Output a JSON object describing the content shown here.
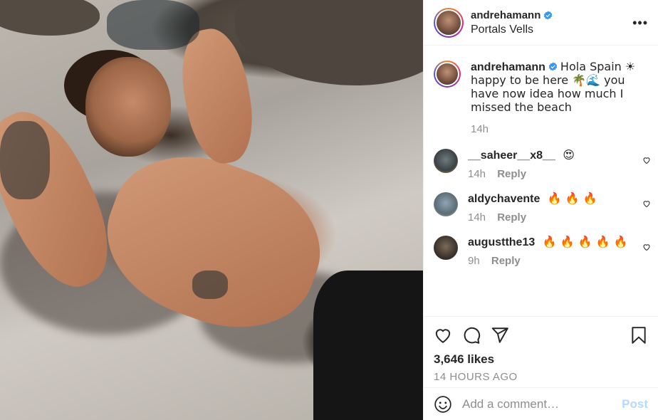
{
  "post": {
    "username": "andrehamann",
    "location": "Portals Vells",
    "more_label": "•••"
  },
  "caption": {
    "username": "andrehamann",
    "text": "Hola Spain ☀ happy to be here 🌴🌊 you have now idea how much I missed the beach",
    "time": "14h"
  },
  "comments": [
    {
      "username": "__saheer__x8__",
      "text": "😍",
      "time": "14h",
      "reply_label": "Reply"
    },
    {
      "username": "aldychavente",
      "text": "🔥 🔥 🔥",
      "time": "14h",
      "reply_label": "Reply"
    },
    {
      "username": "augustthe13",
      "text": "🔥 🔥 🔥 🔥 🔥",
      "time": "9h",
      "reply_label": "Reply"
    }
  ],
  "actions": {
    "likes": "3,646 likes",
    "time_ago": "14 HOURS AGO"
  },
  "add_comment": {
    "placeholder": "Add a comment…",
    "post_label": "Post"
  },
  "colors": {
    "verified": "#3897f0",
    "post_disabled": "#b3dbff",
    "secondary_text": "#8e8e8e"
  }
}
